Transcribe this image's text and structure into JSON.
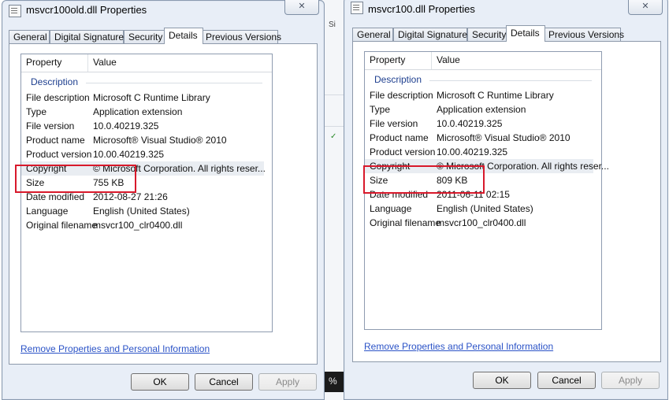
{
  "background": {
    "fragments": [
      "Si",
      "✓"
    ],
    "taskbar_text": "%"
  },
  "dialogs": [
    {
      "title": "msvcr100old.dll Properties",
      "close_label": "✕",
      "tabs": [
        "General",
        "Digital Signatures",
        "Security",
        "Details",
        "Previous Versions"
      ],
      "active_tab": "Details",
      "list_headers": {
        "property": "Property",
        "value": "Value"
      },
      "group": "Description",
      "rows": [
        {
          "property": "File description",
          "value": "Microsoft C Runtime Library"
        },
        {
          "property": "Type",
          "value": "Application extension"
        },
        {
          "property": "File version",
          "value": "10.0.40219.325"
        },
        {
          "property": "Product name",
          "value": "Microsoft® Visual Studio® 2010"
        },
        {
          "property": "Product version",
          "value": "10.00.40219.325"
        },
        {
          "property": "Copyright",
          "value": "© Microsoft Corporation.  All rights reser..."
        },
        {
          "property": "Size",
          "value": "755 KB"
        },
        {
          "property": "Date modified",
          "value": "2012-08-27 21:26"
        },
        {
          "property": "Language",
          "value": "English (United States)"
        },
        {
          "property": "Original filename",
          "value": "msvcr100_clr0400.dll"
        }
      ],
      "remove_link": "Remove Properties and Personal Information",
      "buttons": {
        "ok": "OK",
        "cancel": "Cancel",
        "apply": "Apply"
      }
    },
    {
      "title": "msvcr100.dll Properties",
      "close_label": "✕",
      "tabs": [
        "General",
        "Digital Signatures",
        "Security",
        "Details",
        "Previous Versions"
      ],
      "active_tab": "Details",
      "list_headers": {
        "property": "Property",
        "value": "Value"
      },
      "group": "Description",
      "rows": [
        {
          "property": "File description",
          "value": "Microsoft C Runtime Library"
        },
        {
          "property": "Type",
          "value": "Application extension"
        },
        {
          "property": "File version",
          "value": "10.0.40219.325"
        },
        {
          "property": "Product name",
          "value": "Microsoft® Visual Studio® 2010"
        },
        {
          "property": "Product version",
          "value": "10.00.40219.325"
        },
        {
          "property": "Copyright",
          "value": "© Microsoft Corporation.  All rights reser..."
        },
        {
          "property": "Size",
          "value": "809 KB"
        },
        {
          "property": "Date modified",
          "value": "2011-06-11 02:15"
        },
        {
          "property": "Language",
          "value": "English (United States)"
        },
        {
          "property": "Original filename",
          "value": "msvcr100_clr0400.dll"
        }
      ],
      "remove_link": "Remove Properties and Personal Information",
      "buttons": {
        "ok": "OK",
        "cancel": "Cancel",
        "apply": "Apply"
      }
    }
  ],
  "colors": {
    "highlight": "#d8192b",
    "link": "#2b53c7",
    "group_label": "#1e3f8f"
  }
}
